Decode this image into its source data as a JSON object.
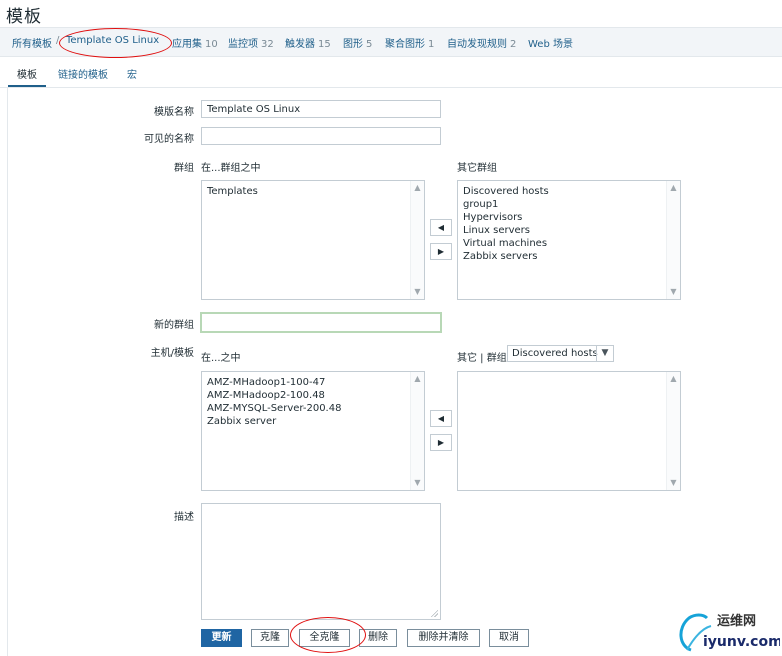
{
  "page": {
    "title": "模板"
  },
  "breadcrumb": [
    {
      "label": "所有模板",
      "count": ""
    },
    {
      "label": "Template OS Linux",
      "count": ""
    },
    {
      "label": "应用集",
      "count": "10"
    },
    {
      "label": "监控项",
      "count": "32"
    },
    {
      "label": "触发器",
      "count": "15"
    },
    {
      "label": "图形",
      "count": "5"
    },
    {
      "label": "聚合图形",
      "count": "1"
    },
    {
      "label": "自动发现规则",
      "count": "2"
    },
    {
      "label": "Web 场景",
      "count": ""
    }
  ],
  "breadcrumb_separator": "/",
  "tabs": [
    {
      "label": "模板",
      "active": true
    },
    {
      "label": "链接的模板",
      "active": false
    },
    {
      "label": "宏",
      "active": false
    }
  ],
  "form": {
    "template_name": {
      "label": "模版名称",
      "value": "Template OS Linux"
    },
    "visible_name": {
      "label": "可见的名称",
      "value": ""
    },
    "groups": {
      "label": "群组",
      "in_header": "在...群组之中",
      "other_header": "其它群组",
      "in_items": [
        "Templates"
      ],
      "other_items": [
        "Discovered hosts",
        "group1",
        "Hypervisors",
        "Linux servers",
        "Virtual machines",
        "Zabbix servers"
      ]
    },
    "new_group": {
      "label": "新的群组",
      "value": ""
    },
    "hosts": {
      "label": "主机/模板",
      "in_header": "在...之中",
      "other_header": "其它 | 群组",
      "group_select": "Discovered hosts",
      "in_items": [
        "AMZ-MHadoop1-100-47",
        "AMZ-MHadoop2-100.48",
        "AMZ-MYSQL-Server-200.48",
        "Zabbix server"
      ],
      "other_items": []
    },
    "description": {
      "label": "描述",
      "value": ""
    }
  },
  "buttons": {
    "update": "更新",
    "clone": "克隆",
    "full_clone": "全克隆",
    "delete": "删除",
    "delete_clear": "删除并清除",
    "cancel": "取消"
  },
  "icons": {
    "move_left": "◀",
    "move_right": "▶",
    "scroll_up": "▲",
    "scroll_down": "▼",
    "select_arrow": "▼"
  },
  "watermark": {
    "brand": "运维网",
    "domain": "iyunv.com"
  },
  "colors": {
    "link": "#1f5f8a",
    "primary_button": "#1f65a3",
    "annotation": "#e01010"
  }
}
